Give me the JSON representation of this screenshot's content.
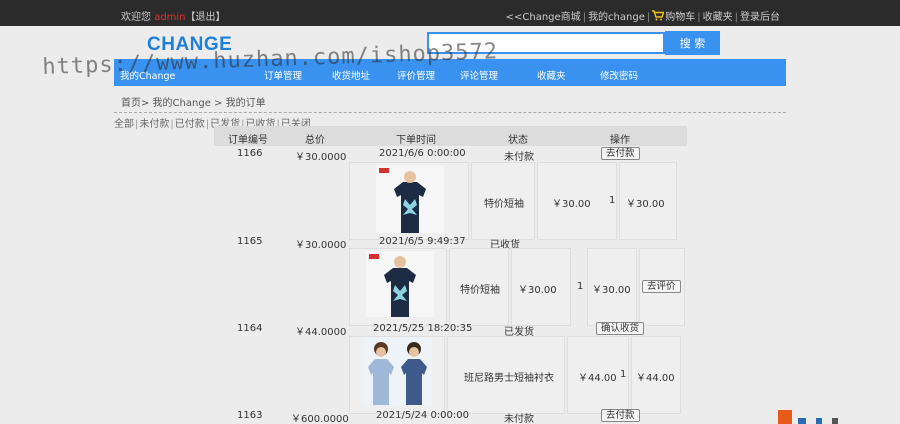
{
  "topbar": {
    "welcome_prefix": "欢迎您",
    "username": "admin",
    "logout": "【退出】",
    "links": [
      "<<Change商城",
      "我的change",
      "购物车",
      "收藏夹",
      "登录后台"
    ],
    "sep": "|"
  },
  "header": {
    "logo": "CHANGE",
    "search_placeholder": "",
    "search_button": "搜 索"
  },
  "nav": {
    "items": [
      "我的Change",
      "订单管理",
      "收货地址",
      "评价管理",
      "评论管理",
      "收藏夹",
      "修改密码"
    ]
  },
  "watermark": "https://www.huzhan.com/ishop3572",
  "breadcrumb": "首页> 我的Change > 我的订单",
  "filters": [
    "全部",
    "未付款",
    "已付款",
    "已发货",
    "已收货",
    "已关闭"
  ],
  "table": {
    "headers": [
      "订单编号",
      "总价",
      "下单时间",
      "状态",
      "操作"
    ],
    "orders": [
      {
        "id": "1166",
        "total": "￥30.0000",
        "time": "2021/6/6 0:00:00",
        "status": "未付款",
        "action": "去付款",
        "item": {
          "name": "特价短袖",
          "price": "￥30.00",
          "qty": "1",
          "subtotal": "￥30.00",
          "item_action": ""
        }
      },
      {
        "id": "1165",
        "total": "￥30.0000",
        "time": "2021/6/5 9:49:37",
        "status": "已收货",
        "action": "",
        "item": {
          "name": "特价短袖",
          "price": "￥30.00",
          "qty": "1",
          "subtotal": "￥30.00",
          "item_action": "去评价"
        }
      },
      {
        "id": "1164",
        "total": "￥44.0000",
        "time": "2021/5/25 18:20:35",
        "status": "已发货",
        "action": "确认收货",
        "item": {
          "name": "班尼路男士短袖衬衣",
          "price": "￥44.00",
          "qty": "1",
          "subtotal": "￥44.00",
          "item_action": ""
        }
      },
      {
        "id": "1163",
        "total": "￥600.0000",
        "time": "2021/5/24 0:00:00",
        "status": "未付款",
        "action": "去付款"
      }
    ]
  },
  "colors": {
    "accent": "#3a92f0",
    "topbar": "#2b2b2b",
    "username": "#e03030",
    "logo": "#1e80d8"
  },
  "icons": [
    "cart-icon",
    "tshirt-product-image",
    "shirt-product-image"
  ]
}
